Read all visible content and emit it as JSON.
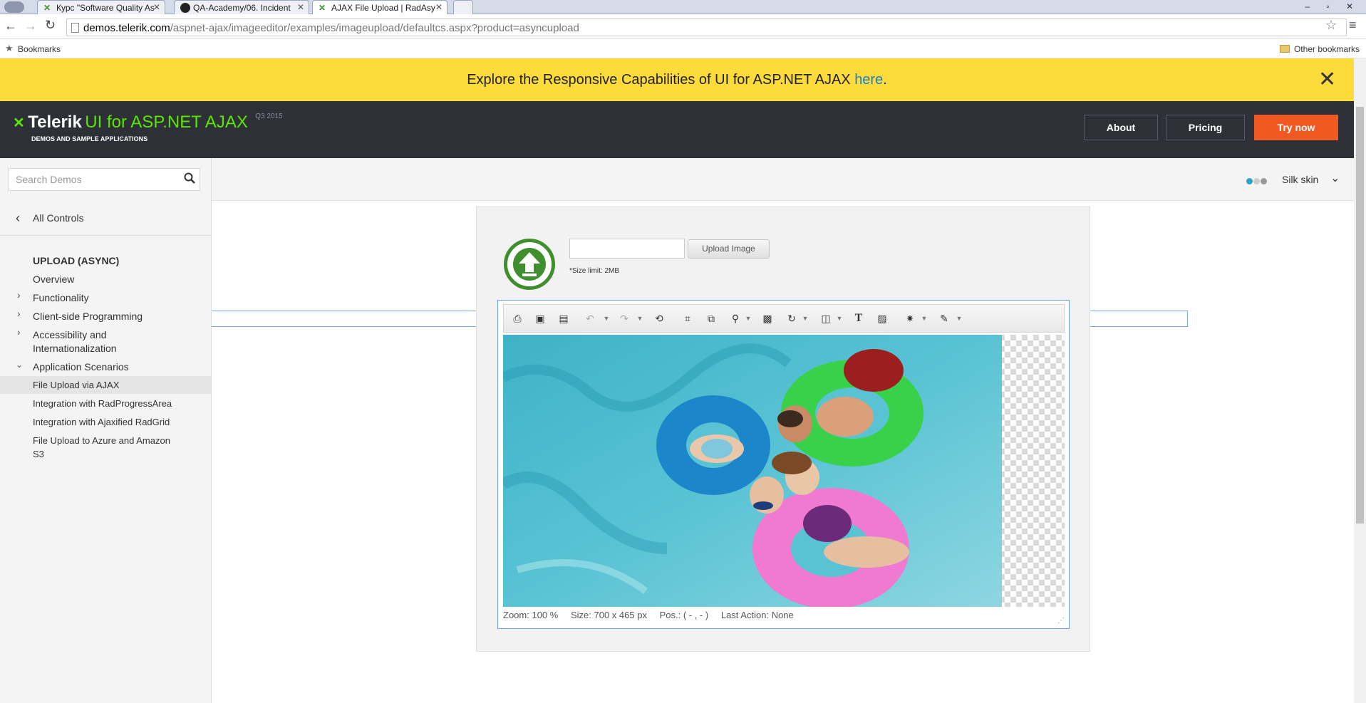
{
  "browser": {
    "tabs": [
      {
        "title": "Курс \"Software Quality As"
      },
      {
        "title": "QA-Academy/06. Incident"
      },
      {
        "title": "AJAX File Upload | RadAsy"
      }
    ],
    "url_host": "demos.telerik.com",
    "url_path": "/aspnet-ajax/imageeditor/examples/imageupload/defaultcs.aspx?product=asyncupload",
    "bookmarks_label": "Bookmarks",
    "other_bookmarks_label": "Other bookmarks"
  },
  "banner": {
    "text": "Explore the Responsive Capabilities of UI for ASP.NET AJAX ",
    "link": "here",
    "end": "."
  },
  "header": {
    "brand": "Telerik",
    "product": "UI for ASP.NET AJAX",
    "version": "Q3 2015",
    "tagline": "DEMOS AND SAMPLE APPLICATIONS",
    "about": "About",
    "pricing": "Pricing",
    "try_now": "Try now"
  },
  "sidebar": {
    "search_placeholder": "Search Demos",
    "all_controls": "All Controls",
    "section_title": "UPLOAD (ASYNC)",
    "overview": "Overview",
    "functionality": "Functionality",
    "client_side": "Client-side Programming",
    "accessibility_1": "Accessibility and",
    "accessibility_2": "Internationalization",
    "app_scenarios": "Application Scenarios",
    "items": [
      "File Upload via AJAX",
      "Integration with RadProgressArea",
      "Integration with Ajaxified RadGrid",
      "File Upload to Azure and Amazon",
      "S3"
    ]
  },
  "topbar": {
    "skin": "Silk skin"
  },
  "upload": {
    "button": "Upload Image",
    "size_limit": "*Size limit: 2MB"
  },
  "status": {
    "zoom_label": "Zoom:",
    "zoom_value": "100 %",
    "size_label": "Size:",
    "size_value": "700 x 465 px",
    "pos_label": "Pos.:",
    "pos_value": "( - , - )",
    "action_label": "Last Action:",
    "action_value": "None"
  },
  "colors": {
    "banner": "#fddb3a",
    "header": "#2d3037",
    "accent": "#f05a22",
    "green": "#3f8f2f",
    "link": "#1a7fc9"
  }
}
